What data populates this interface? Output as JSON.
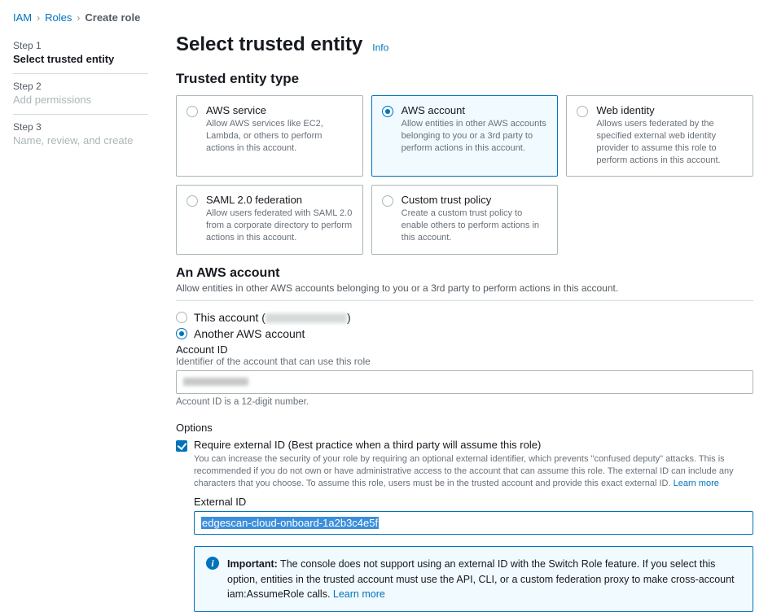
{
  "breadcrumb": {
    "items": [
      {
        "label": "IAM"
      },
      {
        "label": "Roles"
      },
      {
        "label": "Create role"
      }
    ]
  },
  "steps": {
    "items": [
      {
        "num": "Step 1",
        "title": "Select trusted entity",
        "active": true
      },
      {
        "num": "Step 2",
        "title": "Add permissions",
        "active": false
      },
      {
        "num": "Step 3",
        "title": "Name, review, and create",
        "active": false
      }
    ]
  },
  "header": {
    "title": "Select trusted entity",
    "info_label": "Info"
  },
  "entity_section": {
    "title": "Trusted entity type",
    "cards": [
      {
        "title": "AWS service",
        "desc": "Allow AWS services like EC2, Lambda, or others to perform actions in this account.",
        "selected": false
      },
      {
        "title": "AWS account",
        "desc": "Allow entities in other AWS accounts belonging to you or a 3rd party to perform actions in this account.",
        "selected": true
      },
      {
        "title": "Web identity",
        "desc": "Allows users federated by the specified external web identity provider to assume this role to perform actions in this account.",
        "selected": false
      },
      {
        "title": "SAML 2.0 federation",
        "desc": "Allow users federated with SAML 2.0 from a corporate directory to perform actions in this account.",
        "selected": false
      },
      {
        "title": "Custom trust policy",
        "desc": "Create a custom trust policy to enable others to perform actions in this account.",
        "selected": false
      }
    ]
  },
  "aws_account": {
    "title": "An AWS account",
    "desc": "Allow entities in other AWS accounts belonging to you or a 3rd party to perform actions in this account.",
    "this_account_label": "This account (",
    "this_account_suffix": ")",
    "another_account_label": "Another AWS account",
    "another_selected": true,
    "account_id_label": "Account ID",
    "account_id_hint": "Identifier of the account that can use this role",
    "account_id_value": "",
    "account_id_below": "Account ID is a 12-digit number."
  },
  "options": {
    "title": "Options",
    "require_external_id": {
      "checked": true,
      "label": "Require external ID (Best practice when a third party will assume this role)",
      "desc": "You can increase the security of your role by requiring an optional external identifier, which prevents \"confused deputy\" attacks. This is recommended if you do not own or have administrative access to the account that can assume this role. The external ID can include any characters that you choose. To assume this role, users must be in the trusted account and provide this exact external ID. ",
      "learn_more": "Learn more",
      "ext_id_label": "External ID",
      "ext_id_value": "edgescan-cloud-onboard-1a2b3c4e5f"
    }
  },
  "infobox": {
    "leading": "Important:",
    "text": " The console does not support using an external ID with the Switch Role feature. If you select this option, entities in the trusted account must use the API, CLI, or a custom federation proxy to make cross-account iam:AssumeRole calls. ",
    "learn_more": "Learn more"
  }
}
